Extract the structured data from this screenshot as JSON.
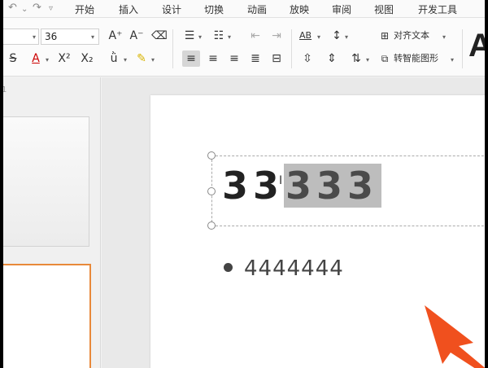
{
  "menu": {
    "tabs": [
      "开始",
      "插入",
      "设计",
      "切换",
      "动画",
      "放映",
      "审阅",
      "视图",
      "开发工具"
    ]
  },
  "ribbon": {
    "font_size": "36",
    "increase_font": "A⁺",
    "decrease_font": "A⁻",
    "superscript": "X²",
    "subscript": "X₂",
    "text_direction_label": "AB",
    "align_text_label": "对齐文本",
    "smart_art_label": "转智能图形",
    "big_letter": "A"
  },
  "thumbnails": {
    "slide_number": "1"
  },
  "slide": {
    "title_plain": "33",
    "title_selected": "333",
    "bullet_text": "4444444"
  },
  "colors": {
    "accent_orange": "#e8893a",
    "arrow": "#f0501e",
    "selection": "#bdbdbd"
  }
}
